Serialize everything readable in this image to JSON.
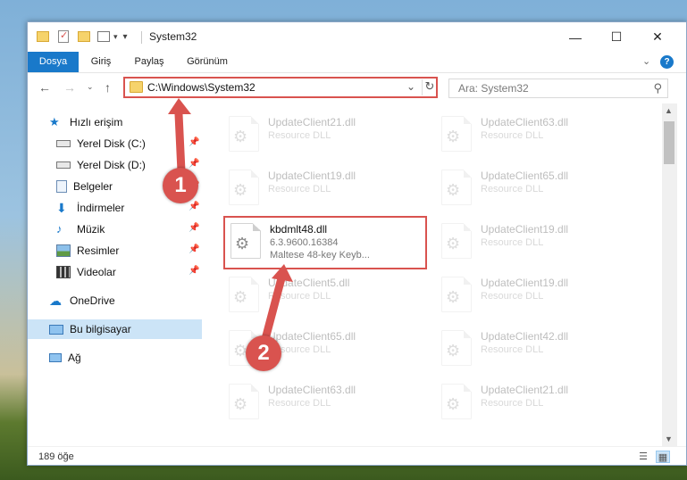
{
  "titlebar": {
    "title": "System32",
    "minimize": "—",
    "maximize": "☐",
    "close": "✕"
  },
  "ribbon": {
    "tabs": [
      "Dosya",
      "Giriş",
      "Paylaş",
      "Görünüm"
    ],
    "active_tab": "Dosya",
    "expand_icon": "chevron-down-icon",
    "help_label": "?"
  },
  "navbar": {
    "address": "C:\\Windows\\System32",
    "search_placeholder": "Ara: System32"
  },
  "nav_pane": {
    "items": [
      {
        "label": "Hızlı erişim",
        "icon": "star-icon"
      },
      {
        "label": "Yerel Disk (C:)",
        "icon": "drive-icon"
      },
      {
        "label": "Yerel Disk (D:)",
        "icon": "drive-icon"
      },
      {
        "label": "Belgeler",
        "icon": "document-icon"
      },
      {
        "label": "İndirmeler",
        "icon": "download-icon"
      },
      {
        "label": "Müzik",
        "icon": "music-icon"
      },
      {
        "label": "Resimler",
        "icon": "pictures-icon"
      },
      {
        "label": "Videolar",
        "icon": "video-icon"
      },
      {
        "label": "OneDrive",
        "icon": "cloud-icon"
      },
      {
        "label": "Bu bilgisayar",
        "icon": "computer-icon"
      },
      {
        "label": "Ağ",
        "icon": "network-icon"
      }
    ],
    "selected": "Bu bilgisayar"
  },
  "files": {
    "left_column": [
      {
        "name": "UpdateClient21.dll",
        "type": "Resource DLL"
      },
      {
        "name": "UpdateClient19.dll",
        "type": "Resource DLL"
      },
      {
        "name": "kbdmlt48.dll",
        "version": "6.3.9600.16384",
        "description": "Maltese 48-key Keyb..."
      },
      {
        "name": "UpdateClient5.dll",
        "type": "Resource DLL"
      },
      {
        "name": "UpdateClient65.dll",
        "type": "Resource DLL"
      },
      {
        "name": "UpdateClient63.dll",
        "type": "Resource DLL"
      }
    ],
    "right_column": [
      {
        "name": "UpdateClient63.dll",
        "type": "Resource DLL"
      },
      {
        "name": "UpdateClient65.dll",
        "type": "Resource DLL"
      },
      {
        "name": "UpdateClient19.dll",
        "type": "Resource DLL"
      },
      {
        "name": "UpdateClient19.dll",
        "type": "Resource DLL"
      },
      {
        "name": "UpdateClient42.dll",
        "type": "Resource DLL"
      },
      {
        "name": "UpdateClient21.dll",
        "type": "Resource DLL"
      }
    ]
  },
  "status": {
    "item_count": "189 öğe"
  },
  "annotations": {
    "step1": "1",
    "step2": "2",
    "color": "#d9534f"
  },
  "colors": {
    "accent": "#1979ca",
    "selection": "#cce4f7",
    "highlight": "#d9534f",
    "folder": "#f6d36b"
  }
}
